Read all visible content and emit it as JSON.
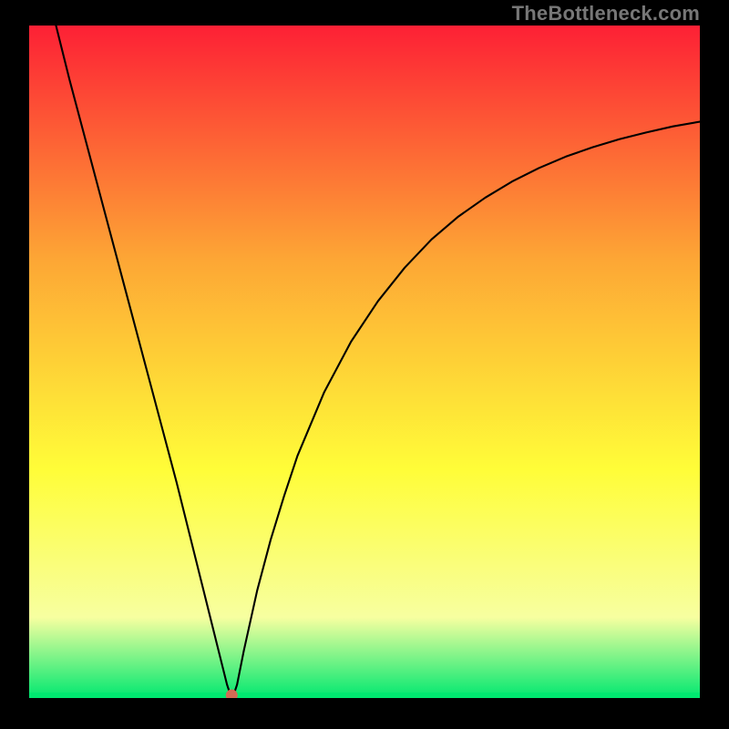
{
  "watermark": "TheBottleneck.com",
  "chart_data": {
    "type": "line",
    "title": "",
    "xlabel": "",
    "ylabel": "",
    "xlim": [
      0,
      100
    ],
    "ylim": [
      0,
      100
    ],
    "grid": false,
    "background_gradient": {
      "top": "#fd2035",
      "mid_upper": "#fda735",
      "mid": "#fffd38",
      "lower": "#f7ffa0",
      "bottom": "#00e870"
    },
    "series": [
      {
        "name": "bottleneck-curve",
        "type": "line",
        "color": "#000000",
        "x": [
          4,
          6,
          8,
          10,
          12,
          14,
          16,
          18,
          20,
          22,
          24,
          25,
          26,
          27,
          28,
          29,
          29.5,
          30,
          30.5,
          31,
          32,
          34,
          36,
          38,
          40,
          44,
          48,
          52,
          56,
          60,
          64,
          68,
          72,
          76,
          80,
          84,
          88,
          92,
          96,
          100
        ],
        "y": [
          100,
          92,
          84.5,
          77,
          69.5,
          62,
          54.5,
          47,
          39.5,
          32,
          24,
          20,
          16,
          12,
          8,
          4,
          2,
          0.5,
          0.5,
          2,
          7,
          16,
          23.5,
          30,
          36,
          45.5,
          53,
          59,
          64,
          68.2,
          71.6,
          74.4,
          76.8,
          78.8,
          80.5,
          81.9,
          83.1,
          84.1,
          85,
          85.7
        ]
      },
      {
        "name": "marker",
        "type": "scatter",
        "color": "#d46a55",
        "x": [
          30.2
        ],
        "y": [
          0.4
        ]
      }
    ]
  }
}
